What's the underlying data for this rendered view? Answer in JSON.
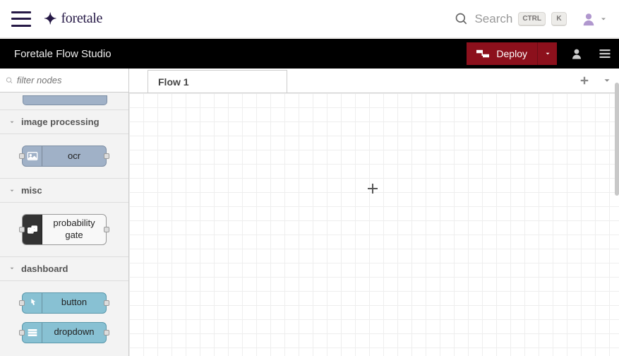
{
  "brand": {
    "name": "foretale"
  },
  "search": {
    "label": "Search",
    "shortcut_mod": "CTRL",
    "shortcut_key": "K"
  },
  "app": {
    "title": "Foretale Flow Studio",
    "deploy_label": "Deploy"
  },
  "filter": {
    "placeholder": "filter nodes"
  },
  "categories": [
    {
      "id": "image-processing",
      "label": "image processing",
      "nodes": [
        {
          "id": "ocr",
          "label": "ocr",
          "variant": "blue",
          "icon": "image",
          "port_l": true,
          "port_r": true
        }
      ]
    },
    {
      "id": "misc",
      "label": "misc",
      "nodes": [
        {
          "id": "probability-gate",
          "label": "probability gate",
          "variant": "white",
          "icon": "dice",
          "port_l": true,
          "port_r": true
        }
      ]
    },
    {
      "id": "dashboard",
      "label": "dashboard",
      "nodes": [
        {
          "id": "button",
          "label": "button",
          "variant": "teal",
          "icon": "pointer",
          "port_l": true,
          "port_r": true
        },
        {
          "id": "dropdown",
          "label": "dropdown",
          "variant": "teal",
          "icon": "list",
          "port_l": true,
          "port_r": true
        }
      ]
    }
  ],
  "tabs": [
    {
      "id": "flow-1",
      "label": "Flow 1",
      "active": true
    }
  ]
}
